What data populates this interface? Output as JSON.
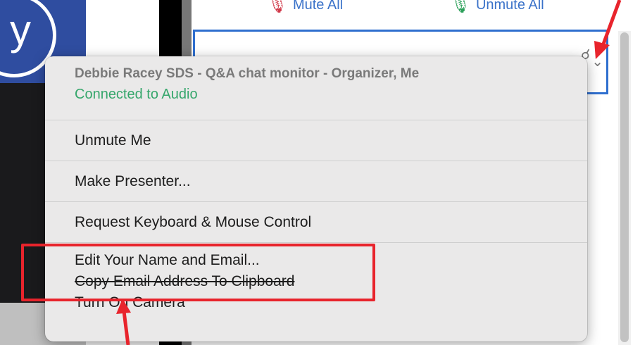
{
  "background": {
    "logo_letter": "y"
  },
  "toolbar": {
    "mute_all_label": "Mute All",
    "unmute_all_label": "Unmute All"
  },
  "context_menu": {
    "title": "Debbie Racey SDS - Q&A chat monitor - Organizer, Me",
    "status": "Connected to Audio",
    "items": [
      {
        "label": "Unmute Me"
      },
      {
        "label": "Make Presenter..."
      },
      {
        "label": "Request Keyboard & Mouse Control"
      },
      {
        "label": "Edit Your Name and Email..."
      },
      {
        "label": "Copy Email Address To Clipboard"
      },
      {
        "label": "Turn On Camera"
      }
    ]
  },
  "colors": {
    "annotation": "#e8242c",
    "status": "#35a66b",
    "accent": "#2f6fcf"
  }
}
